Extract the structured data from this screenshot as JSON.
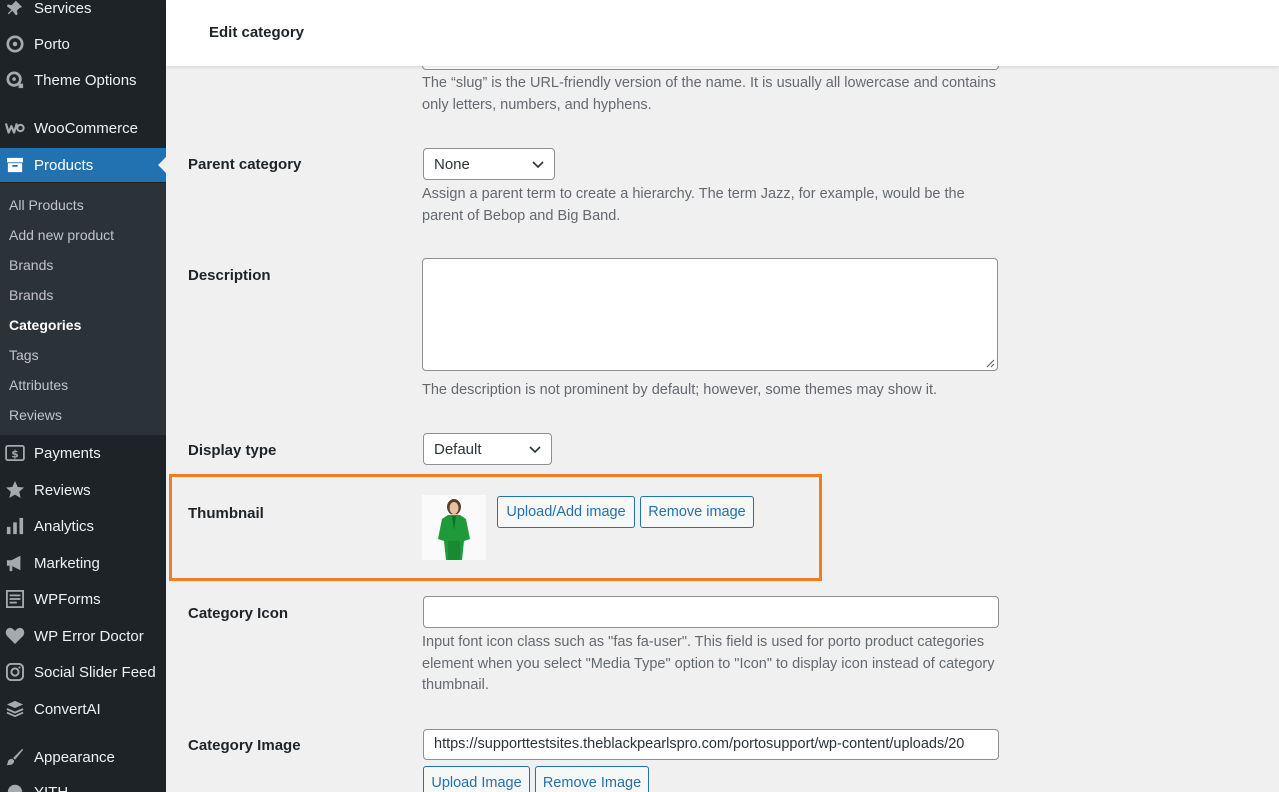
{
  "sidebar": {
    "items": [
      {
        "label": "Services",
        "icon": "pushpin-icon"
      },
      {
        "label": "Porto",
        "icon": "porto-icon"
      },
      {
        "label": "Theme Options",
        "icon": "theme-options-icon"
      },
      {
        "label": "WooCommerce",
        "icon": "woocommerce-icon"
      },
      {
        "label": "Products",
        "icon": "products-icon"
      },
      {
        "label": "Payments",
        "icon": "payments-icon"
      },
      {
        "label": "Reviews",
        "icon": "star-icon"
      },
      {
        "label": "Analytics",
        "icon": "bar-chart-icon"
      },
      {
        "label": "Marketing",
        "icon": "megaphone-icon"
      },
      {
        "label": "WPForms",
        "icon": "forms-icon"
      },
      {
        "label": "WP Error Doctor",
        "icon": "heart-icon"
      },
      {
        "label": "Social Slider Feed",
        "icon": "instagram-icon"
      },
      {
        "label": "ConvertAI",
        "icon": "layers-icon"
      },
      {
        "label": "Appearance",
        "icon": "paintbrush-icon"
      },
      {
        "label": "YITH",
        "icon": "yith-icon"
      }
    ],
    "submenu": [
      "All Products",
      "Add new product",
      "Brands",
      "Brands",
      "Categories",
      "Tags",
      "Attributes",
      "Reviews"
    ],
    "active_submenu": "Categories",
    "current_item": "Products"
  },
  "header": {
    "title": "Edit category"
  },
  "form": {
    "slug_help": "The “slug” is the URL-friendly version of the name. It is usually all lowercase and contains only letters, numbers, and hyphens.",
    "parent": {
      "label": "Parent category",
      "value": "None",
      "help": "Assign a parent term to create a hierarchy. The term Jazz, for example, would be the parent of Bebop and Big Band."
    },
    "description": {
      "label": "Description",
      "value": "",
      "help": "The description is not prominent by default; however, some themes may show it."
    },
    "display_type": {
      "label": "Display type",
      "value": "Default"
    },
    "thumbnail": {
      "label": "Thumbnail",
      "upload_label": "Upload/Add image",
      "remove_label": "Remove image"
    },
    "category_icon": {
      "label": "Category Icon",
      "value": "",
      "help": "Input font icon class such as \"fas fa-user\". This field is used for porto product categories element when you select \"Media Type\" option to \"Icon\" to display icon instead of category thumbnail."
    },
    "category_image": {
      "label": "Category Image",
      "value": "https://supporttestsites.theblackpearlspro.com/portosupport/wp-content/uploads/20",
      "upload_label": "Upload Image",
      "remove_label": "Remove Image"
    }
  },
  "colors": {
    "sidebar_bg": "#1d2327",
    "accent": "#2271b1",
    "highlight": "#f47c20"
  }
}
